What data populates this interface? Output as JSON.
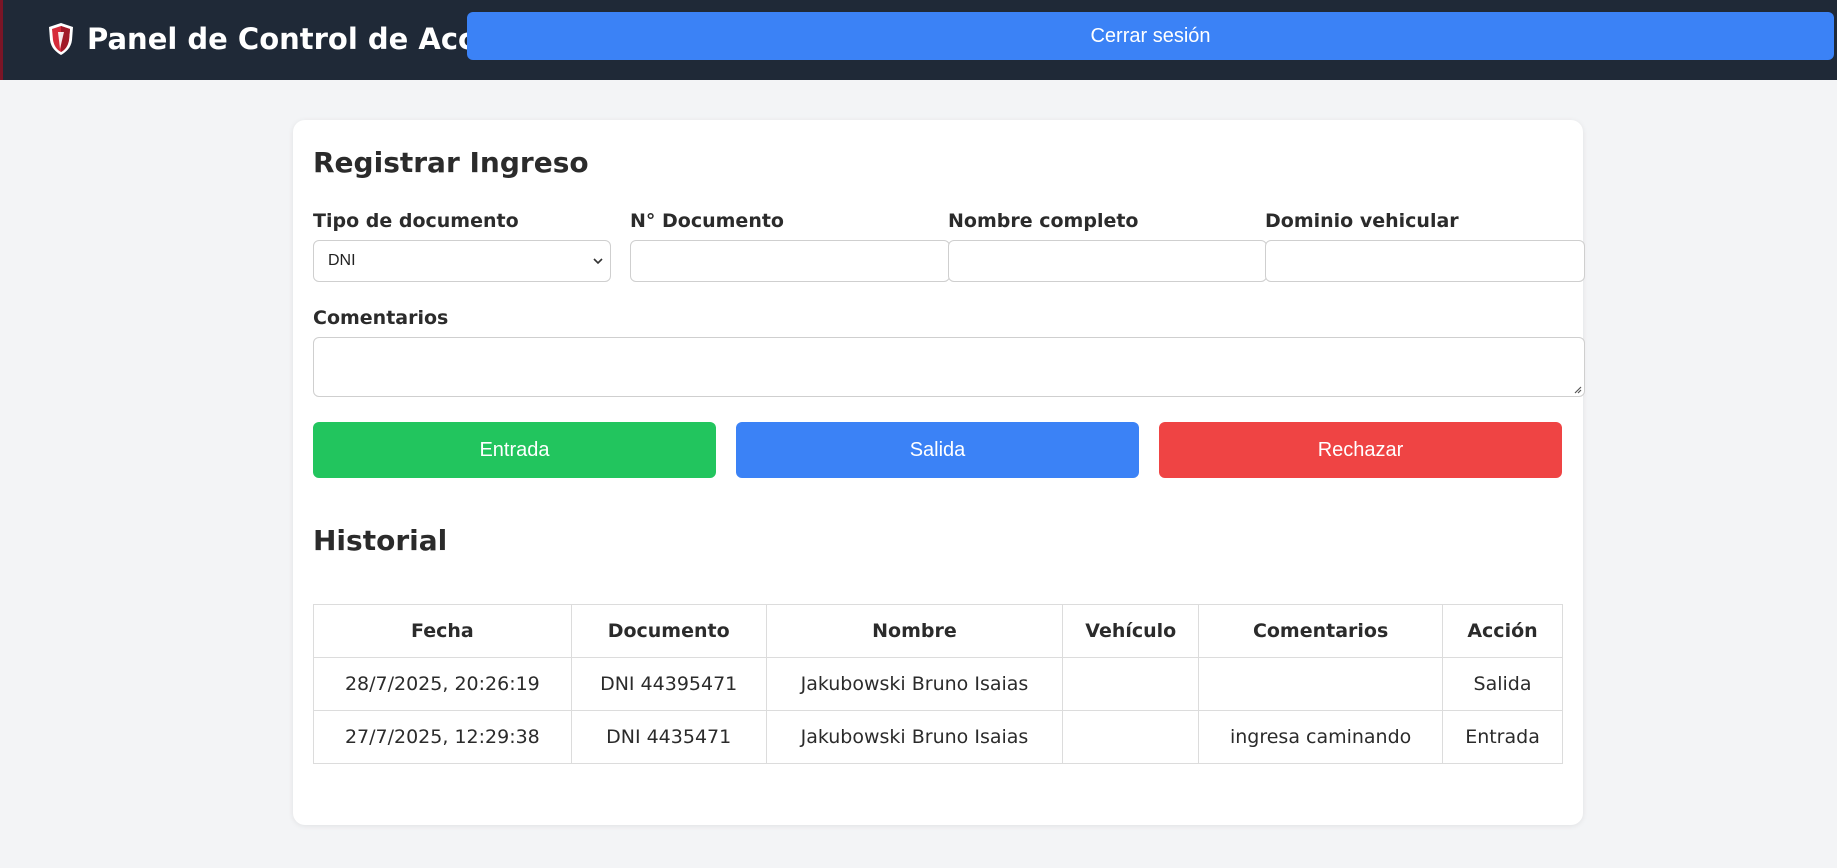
{
  "header": {
    "title": "Panel de Control de Acceso",
    "logout_label": "Cerrar sesión",
    "brand_icon": "shield-icon"
  },
  "form": {
    "title": "Registrar Ingreso",
    "doc_type_label": "Tipo de documento",
    "doc_type_value": "DNI",
    "doc_number_label": "N° Documento",
    "doc_number_value": "",
    "full_name_label": "Nombre completo",
    "full_name_value": "",
    "vehicle_label": "Dominio vehicular",
    "vehicle_value": "",
    "comments_label": "Comentarios",
    "comments_value": "",
    "buttons": {
      "entry": "Entrada",
      "exit": "Salida",
      "reject": "Rechazar"
    }
  },
  "history": {
    "title": "Historial",
    "columns": [
      "Fecha",
      "Documento",
      "Nombre",
      "Vehículo",
      "Comentarios",
      "Acción"
    ],
    "rows": [
      [
        "28/7/2025, 20:26:19",
        "DNI 44395471",
        "Jakubowski Bruno Isaias",
        "",
        "",
        "Salida"
      ],
      [
        "27/7/2025, 12:29:38",
        "DNI 4435471",
        "Jakubowski Bruno Isaias",
        "",
        "ingresa caminando",
        "Entrada"
      ]
    ]
  },
  "colors": {
    "topbar": "#1f2937",
    "primary": "#3b82f6",
    "success": "#22c55e",
    "danger": "#ef4444",
    "background": "#f3f4f6"
  }
}
